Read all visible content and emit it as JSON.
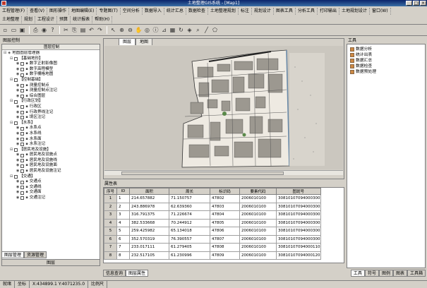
{
  "window": {
    "title": "土地整理GIS系统 - [Map1]"
  },
  "menu": {
    "row1": [
      "工程管理(F)",
      "查看(V)",
      "图形操作",
      "地图编辑(E)",
      "专题图(T)",
      "空间分析",
      "数据导入",
      "统计汇总",
      "数据检查",
      "土地整理规划",
      "标注",
      "规划设计",
      "图表工具",
      "分析工具",
      "打印输出",
      "土地规划设计",
      "窗口(W)"
    ],
    "row2": [
      "土地整理",
      "规划",
      "工程设计",
      "预算",
      "统计报表",
      "帮助(H)"
    ]
  },
  "left": {
    "caption": "图层控制",
    "header": "图层控制",
    "tree": [
      {
        "label": "地图图层管理器",
        "level": 0,
        "kind": "root"
      },
      {
        "label": "【基础地形】",
        "level": 1,
        "kind": "group"
      },
      {
        "label": "数字正射影像图",
        "level": 2,
        "kind": "layer"
      },
      {
        "label": "数字高程模型",
        "level": 2,
        "kind": "layer"
      },
      {
        "label": "数字栅格地图",
        "level": 2,
        "kind": "layer"
      },
      {
        "label": "【控制基础】",
        "level": 1,
        "kind": "group"
      },
      {
        "label": "测量控制点",
        "level": 2,
        "kind": "layer"
      },
      {
        "label": "测量控制点注记",
        "level": 2,
        "kind": "layer"
      },
      {
        "label": "综合图层",
        "level": 2,
        "kind": "layer"
      },
      {
        "label": "【行政区划】",
        "level": 1,
        "kind": "group"
      },
      {
        "label": "行政区",
        "level": 2,
        "kind": "layer"
      },
      {
        "label": "行政界线注记",
        "level": 2,
        "kind": "layer"
      },
      {
        "label": "境区注记",
        "level": 2,
        "kind": "layer"
      },
      {
        "label": "【水系】",
        "level": 1,
        "kind": "group"
      },
      {
        "label": "水系点",
        "level": 2,
        "kind": "layer"
      },
      {
        "label": "水系线",
        "level": 2,
        "kind": "layer"
      },
      {
        "label": "水系面",
        "level": 2,
        "kind": "layer"
      },
      {
        "label": "水系注记",
        "level": 2,
        "kind": "layer"
      },
      {
        "label": "【居民地及设施】",
        "level": 1,
        "kind": "group"
      },
      {
        "label": "居民地及设施点",
        "level": 2,
        "kind": "layer"
      },
      {
        "label": "居民地及设施线",
        "level": 2,
        "kind": "layer"
      },
      {
        "label": "居民地及设施面",
        "level": 2,
        "kind": "layer"
      },
      {
        "label": "居民地及设施注记",
        "level": 2,
        "kind": "layer"
      },
      {
        "label": "【交通】",
        "level": 1,
        "kind": "group"
      },
      {
        "label": "交通点",
        "level": 2,
        "kind": "layer"
      },
      {
        "label": "交通线",
        "level": 2,
        "kind": "layer"
      },
      {
        "label": "交通面",
        "level": 2,
        "kind": "layer"
      },
      {
        "label": "交通注记",
        "level": 2,
        "kind": "layer"
      }
    ],
    "tabs": [
      "图层管理",
      "资源管理"
    ],
    "bottom_tab": "图层"
  },
  "map": {
    "tabs": [
      "图层",
      "地图"
    ]
  },
  "attr": {
    "caption": "属性表",
    "columns": [
      "序号",
      "ID",
      "面积",
      "周长",
      "标识码",
      "要素代码",
      "图斑号"
    ],
    "rows": [
      [
        "1",
        "1",
        "214.657882",
        "71.150757",
        "47802",
        "2006010100",
        "30810107094000300"
      ],
      [
        "2",
        "2",
        "243.886978",
        "62.639360",
        "47803",
        "2006010100",
        "30810107094000300"
      ],
      [
        "3",
        "3",
        "316.791375",
        "71.226674",
        "47804",
        "2006010100",
        "30810107094000300"
      ],
      [
        "4",
        "4",
        "382.533668",
        "70.244912",
        "47805",
        "2006010100",
        "30810107094000300"
      ],
      [
        "5",
        "5",
        "259.425982",
        "65.134018",
        "47806",
        "2006010100",
        "30810107094000300"
      ],
      [
        "6",
        "6",
        "352.570319",
        "76.390557",
        "47807",
        "2006010100",
        "30810107094000300"
      ],
      [
        "7",
        "7",
        "233.017111",
        "61.279405",
        "47808",
        "2006010100",
        "30810107094000110"
      ],
      [
        "8",
        "8",
        "232.517105",
        "61.230996",
        "47809",
        "2006010100",
        "30810107094000120"
      ]
    ],
    "tabs": [
      "信息查询",
      "图层属性"
    ]
  },
  "right": {
    "caption": "工具",
    "tools": [
      "数据分析",
      "统计出表",
      "数据汇总",
      "数据检查",
      "数据预处理"
    ],
    "tabs": [
      "工具",
      "符号",
      "图例",
      "图表",
      "工具箱"
    ]
  },
  "status": {
    "cells": [
      "就绪",
      "坐标",
      "X:434899.1 Y:4071235.0",
      "比例尺"
    ]
  },
  "colors": {
    "title_bar": "#0a246a",
    "window_bg": "#d4d0c8",
    "map_bg": "#cfcbc3"
  }
}
